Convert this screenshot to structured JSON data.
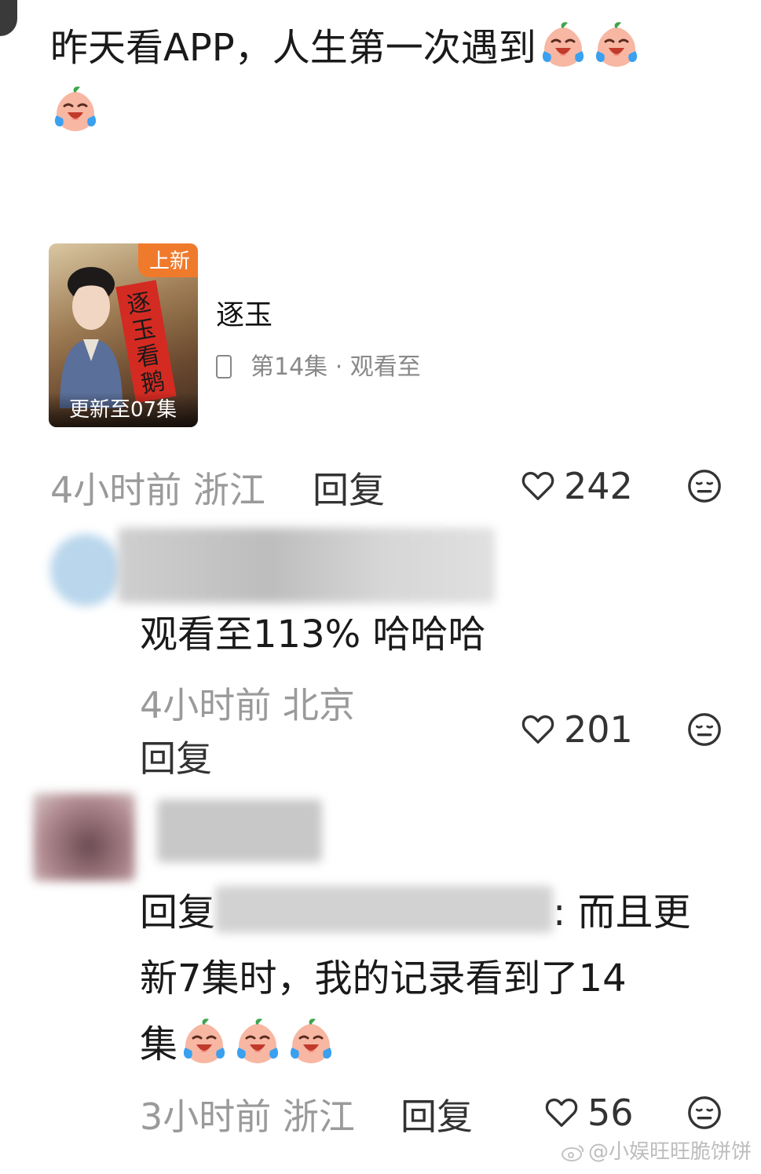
{
  "post": {
    "text": "昨天看APP，人生第一次遇到"
  },
  "card": {
    "badge": "上新",
    "calligraphy": "逐玉看鹅",
    "update": "更新至07集",
    "title": "逐玉",
    "subtitle": "第14集 · 观看至"
  },
  "post_meta": {
    "time": "4小时前",
    "location": "浙江",
    "reply": "回复",
    "likes": "242"
  },
  "comment1": {
    "text": "观看至113% 哈哈哈",
    "time": "4小时前",
    "location": "北京",
    "reply": "回复",
    "likes": "201"
  },
  "comment2": {
    "reply_prefix": "回复",
    "text_part1": ": 而且更",
    "text_line2": "新7集时，我的记录看到了14",
    "text_line3": "集",
    "time": "3小时前",
    "location": "浙江",
    "reply": "回复",
    "likes": "56"
  },
  "watermark": "@小娱旺旺脆饼饼",
  "icons": {
    "emoji": "crying-laughing-peach-emoji",
    "like": "heart-outline-icon",
    "dislike": "meh-face-icon",
    "phone": "phone-icon",
    "weibo": "weibo-logo-icon"
  },
  "colors": {
    "meta": "#9a9a9a",
    "badge": "#f07a2b",
    "banner": "#d32b22"
  }
}
